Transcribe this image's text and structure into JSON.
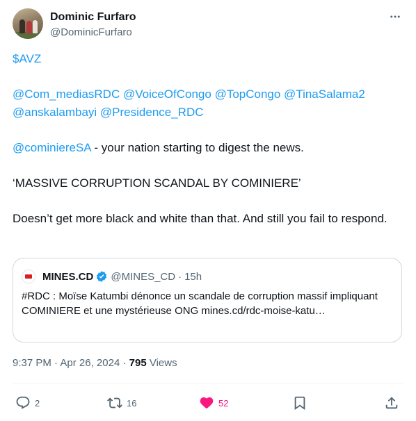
{
  "author": {
    "name": "Dominic Furfaro",
    "handle": "@DominicFurfaro"
  },
  "tweet": {
    "cashtag": "$AVZ",
    "mentions_line1": "@Com_mediasRDC @VoiceOfCongo @TopCongo @TinaSalama2",
    "mentions_line2": "@anskalambayi @Presidence_RDC",
    "mention_cominiere": "@cominiereSA",
    "after_mention": " - your nation starting to digest the news.",
    "quote_line": "‘MASSIVE CORRUPTION SCANDAL BY COMINIERE’",
    "closing": "Doesn’t get more black and white than that. And still you fail to respond."
  },
  "quoted": {
    "name": "MINES.CD",
    "handle": "@MINES_CD",
    "separator": "·",
    "time": "15h",
    "text": "#RDC : Moïse Katumbi dénonce un scandale de corruption massif impliquant COMINIERE et une mystérieuse ONG mines.cd/rdc-moise-katu…"
  },
  "meta": {
    "time": "9:37 PM",
    "sep1": " · ",
    "date": "Apr 26, 2024",
    "sep2": " · ",
    "views_count": "795",
    "views_label": " Views"
  },
  "actions": {
    "replies": "2",
    "reposts": "16",
    "likes": "52"
  },
  "colors": {
    "link": "#1d9bf0",
    "like": "#f91880",
    "muted": "#536471",
    "verified": "#1d9bf0"
  },
  "icons": [
    "more-icon",
    "verified-icon",
    "reply-icon",
    "repost-icon",
    "heart-icon",
    "bookmark-icon",
    "share-icon"
  ]
}
